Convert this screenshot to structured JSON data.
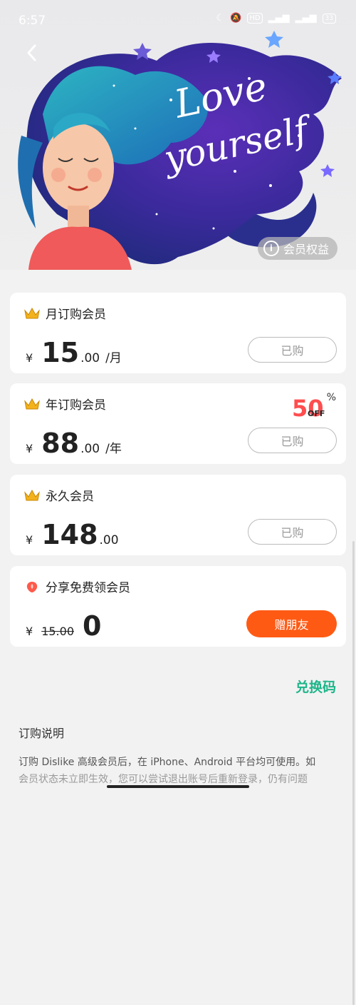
{
  "status": {
    "time": "6:57",
    "hd_badge": "HD",
    "battery": "33"
  },
  "hero": {
    "art_text": [
      "Love",
      "yourself"
    ],
    "benefits_label": "会员权益"
  },
  "plans": [
    {
      "title": "月订购会员",
      "currency": "¥",
      "int": "15",
      "dec": ".00",
      "unit": "/月",
      "button": "已购"
    },
    {
      "title": "年订购会员",
      "currency": "¥",
      "int": "88",
      "dec": ".00",
      "unit": "/年",
      "button": "已购",
      "discount": "50",
      "discount_sub": "OFF",
      "discount_pct": "%"
    },
    {
      "title": "永久会员",
      "currency": "¥",
      "int": "148",
      "dec": ".00",
      "unit": "",
      "button": "已购"
    },
    {
      "title": "分享免费领会员",
      "currency": "¥",
      "original": "15.00",
      "int": "0",
      "button": "赠朋友"
    }
  ],
  "redeem_label": "兑换码",
  "section_title": "订购说明",
  "description": "订购 Dislike 高级会员后，在 iPhone、Android 平台均可使用。如",
  "description_tail": "会员状态未立即生效，您可以尝试退出账号后重新登录，仍有问题",
  "colors": {
    "accent_orange": "#ff5a14",
    "redeem_green": "#1fb58a",
    "discount_red": "#ff4d4f"
  }
}
